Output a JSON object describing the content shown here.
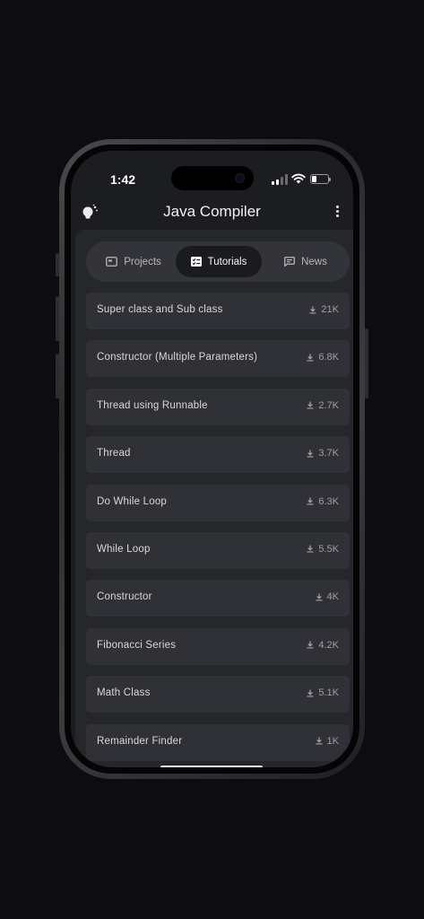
{
  "status_bar": {
    "time": "1:42"
  },
  "header": {
    "title": "Java Compiler"
  },
  "icons": {
    "header_left": "lightbulb-icon",
    "header_right": "more-vertical-icon",
    "tab_projects": "folder-window-icon",
    "tab_tutorials": "checklist-icon",
    "tab_news": "chat-icon",
    "downloads": "download-icon"
  },
  "colors": {
    "background": "#0d0d10",
    "surface": "#26272b",
    "card": "#303136",
    "selected_tab": "#1a1b1e"
  },
  "tabs": [
    {
      "label": "Projects",
      "selected": false
    },
    {
      "label": "Tutorials",
      "selected": true
    },
    {
      "label": "News",
      "selected": false
    }
  ],
  "tutorials": [
    {
      "title": "Super class and Sub class",
      "downloads": "21K"
    },
    {
      "title": "Constructor (Multiple Parameters)",
      "downloads": "6.8K"
    },
    {
      "title": "Thread using Runnable",
      "downloads": "2.7K"
    },
    {
      "title": "Thread",
      "downloads": "3.7K"
    },
    {
      "title": "Do While Loop",
      "downloads": "6.3K"
    },
    {
      "title": "While Loop",
      "downloads": "5.5K"
    },
    {
      "title": "Constructor",
      "downloads": "4K"
    },
    {
      "title": "Fibonacci Series",
      "downloads": "4.2K"
    },
    {
      "title": "Math Class",
      "downloads": "5.1K"
    },
    {
      "title": "Remainder Finder",
      "downloads": "1K"
    }
  ]
}
